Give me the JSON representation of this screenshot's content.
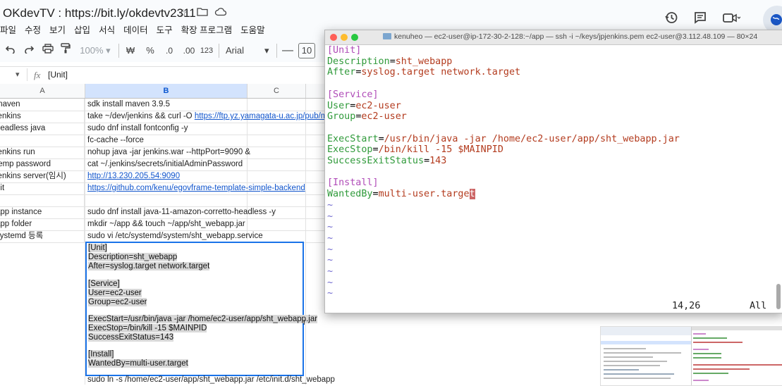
{
  "sheet": {
    "title": "OKdevTV : https://bit.ly/okdevtv2311",
    "menu": [
      "파일",
      "수정",
      "보기",
      "삽입",
      "서식",
      "데이터",
      "도구",
      "확장 프로그램",
      "도움말"
    ],
    "toolbar": {
      "zoom": "100%",
      "currency": "₩",
      "percent": "%",
      "dec_decrease": ".0",
      "dec_increase": ".00",
      "number_format": "123",
      "font": "Arial",
      "font_size": "10"
    },
    "cell_ref": "",
    "formula": "[Unit]",
    "columns": [
      "A",
      "B",
      "C"
    ],
    "rows": [
      {
        "a": "maven",
        "b": "sdk install maven 3.9.5"
      },
      {
        "a": "jenkins",
        "b": "take ~/dev/jenkins && curl -O ",
        "b_link": "https://ftp.yz.yamagata-u.ac.jp/pub/misc"
      },
      {
        "a": "headless java",
        "b": "sudo dnf install fontconfig -y"
      },
      {
        "a": "",
        "b": "fc-cache --force"
      },
      {
        "a": "jenkins run",
        "b": "nohup java -jar jenkins.war --httpPort=9090 &"
      },
      {
        "a": "temp password",
        "b": "cat ~/.jenkins/secrets/initialAdminPassword"
      },
      {
        "a": "jenkins server(임시)",
        "b": "",
        "b_link": "http://13.230.205.54:9090"
      },
      {
        "a": "git",
        "b": "",
        "b_link": "https://github.com/kenu/egovframe-template-simple-backend"
      },
      {
        "a": "",
        "b": ""
      },
      {
        "a": "app instance",
        "b": "sudo dnf install java-11-amazon-corretto-headless -y"
      },
      {
        "a": "app folder",
        "b": "mkdir ~/app && touch ~/app/sht_webapp.jar"
      },
      {
        "a": "systemd 등록",
        "b": "sudo vi /etc/systemd/system/sht_webapp.service"
      }
    ],
    "selected_cell_lines": [
      "[Unit]",
      "Description=sht_webapp",
      "After=syslog.target network.target",
      "",
      "[Service]",
      "User=ec2-user",
      "Group=ec2-user",
      "",
      "ExecStart=/usr/bin/java -jar /home/ec2-user/app/sht_webapp.jar",
      "ExecStop=/bin/kill -15 $MAINPID",
      "SuccessExitStatus=143",
      "",
      "[Install]",
      "WantedBy=multi-user.target"
    ],
    "overflow_char": "r",
    "bottom_row": "sudo ln -s /home/ec2-user/app/sht_webapp.jar /etc/init.d/sht_webapp"
  },
  "terminal": {
    "title": "kenuheo — ec2-user@ip-172-30-2-128:~/app — ssh -i ~/keys/jpjenkins.pem ec2-user@3.112.48.109 — 80×24",
    "lines": [
      {
        "section": "[Unit]"
      },
      {
        "key": "Description",
        "value": "sht_webapp"
      },
      {
        "key": "After",
        "value": "syslog.target network.target"
      },
      {},
      {
        "section": "[Service]"
      },
      {
        "key": "User",
        "value": "ec2-user"
      },
      {
        "key": "Group",
        "value": "ec2-user"
      },
      {},
      {
        "key": "ExecStart",
        "value": "/usr/bin/java -jar /home/ec2-user/app/sht_webapp.jar"
      },
      {
        "key": "ExecStop",
        "value": "/bin/kill -15 $MAINPID"
      },
      {
        "key": "SuccessExitStatus",
        "value": "143"
      },
      {},
      {
        "section": "[Install]"
      },
      {
        "key": "WantedBy",
        "value": "multi-user.targe",
        "cursor": "t"
      }
    ],
    "tilde": "~",
    "tilde_count": 9,
    "status_position": "14,26",
    "status_view": "All",
    "colors": {
      "section": "#b04cb8",
      "key": "#2f9a3a",
      "value": "#b33b1e",
      "tilde": "#6f68cf"
    }
  },
  "icons": [
    "star-icon",
    "move-to-folder-icon",
    "cloud-status-icon",
    "undo-icon",
    "redo-icon",
    "print-icon",
    "paint-format-icon",
    "history-icon",
    "comment-icon",
    "meet-icon",
    "globe-icon"
  ]
}
